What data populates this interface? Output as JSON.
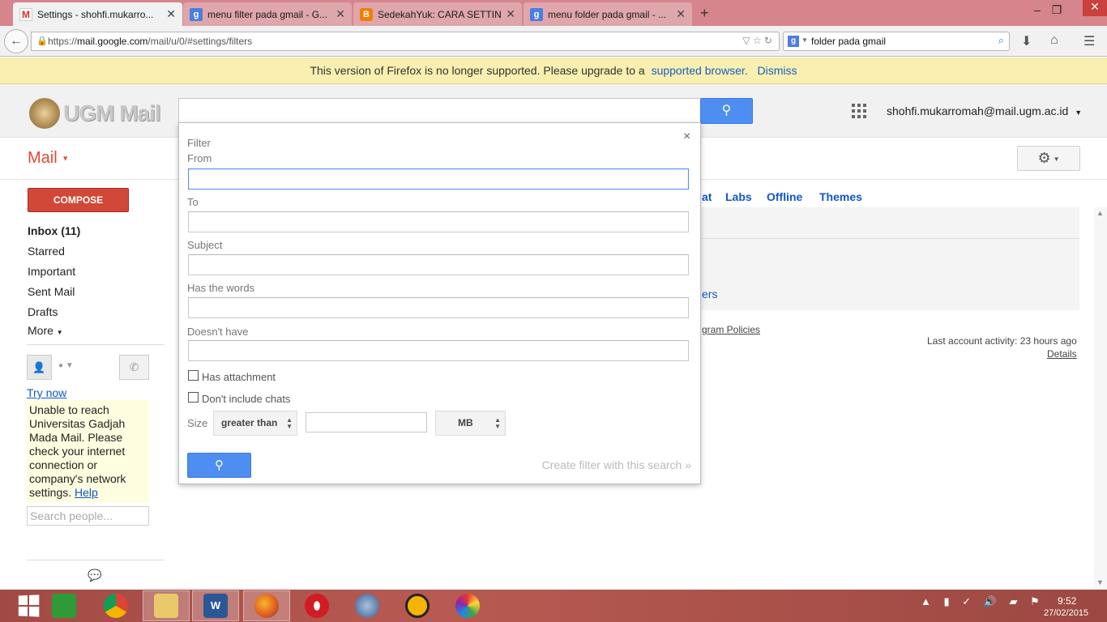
{
  "browser": {
    "tabs": [
      {
        "title": "Settings - shohfi.mukarro...",
        "favicon": "gmail-icon"
      },
      {
        "title": "menu filter pada gmail - G...",
        "favicon": "google-icon"
      },
      {
        "title": "SedekahYuk: CARA SETTIN...",
        "favicon": "blogger-icon"
      },
      {
        "title": "menu folder pada gmail - ...",
        "favicon": "google-icon"
      }
    ],
    "url_prefix": "https://",
    "url_host": "mail.google.com",
    "url_path": "/mail/u/0/#settings/filters",
    "search_text": "folder pada gmail"
  },
  "notification": {
    "message": "This version of Firefox is no longer supported. Please upgrade to a",
    "link": "supported browser.",
    "dismiss": "Dismiss"
  },
  "header": {
    "logo_text": "UGM Mail",
    "account": "shohfi.mukarromah@mail.ugm.ac.id"
  },
  "subheader": {
    "mail_label": "Mail"
  },
  "sidebar": {
    "compose": "COMPOSE",
    "items": [
      "Inbox (11)",
      "Starred",
      "Important",
      "Sent Mail",
      "Drafts",
      "More"
    ],
    "try_now": "Try now",
    "warning": "Unable to reach Universitas Gadjah Mada Mail. Please check your internet connection or company's network settings.",
    "help": "Help",
    "search_people_placeholder": "Search people..."
  },
  "settings": {
    "tabs": [
      "at",
      "Labs",
      "Offline",
      "Themes"
    ],
    "partial_link": "ers",
    "program_policies": "gram Policies",
    "last_activity": "Last account activity: 23 hours ago",
    "details": "Details"
  },
  "filter": {
    "title": "Filter",
    "from_label": "From",
    "to_label": "To",
    "subject_label": "Subject",
    "has_words_label": "Has the words",
    "doesnt_have_label": "Doesn't have",
    "has_attachment": "Has attachment",
    "no_chats": "Don't include chats",
    "size_label": "Size",
    "size_operator": "greater than",
    "size_unit": "MB",
    "create_link": "Create filter with this search »"
  },
  "taskbar": {
    "time": "9:52",
    "date": "27/02/2015"
  }
}
